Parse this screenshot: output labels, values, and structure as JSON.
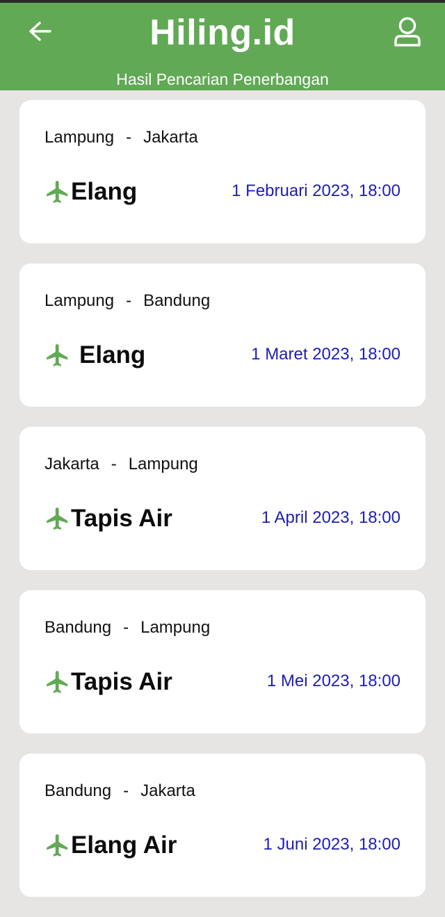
{
  "header": {
    "title": "Hiling.id",
    "subtitle": "Hasil Pencarian Penerbangan",
    "back_icon": "arrow-left-icon",
    "profile_icon": "user-icon",
    "color": "#61a955"
  },
  "flights": [
    {
      "from": "Lampung",
      "to": "Jakarta",
      "airline": "Elang",
      "datetime": "1 Februari 2023, 18:00"
    },
    {
      "from": "Lampung",
      "to": "Bandung",
      "airline": "Elang",
      "datetime": "1 Maret 2023, 18:00"
    },
    {
      "from": "Jakarta",
      "to": "Lampung",
      "airline": "Tapis Air",
      "datetime": "1 April 2023, 18:00"
    },
    {
      "from": "Bandung",
      "to": "Lampung",
      "airline": "Tapis Air",
      "datetime": "1 Mei 2023, 18:00"
    },
    {
      "from": "Bandung",
      "to": "Jakarta",
      "airline": "Elang Air",
      "datetime": "1 Juni 2023, 18:00"
    }
  ],
  "route_separator": "-",
  "icons": {
    "airline": "airplane-icon"
  },
  "colors": {
    "date_text": "#1d1db8",
    "plane_icon": "#61a955",
    "background": "#e6e5e3"
  }
}
